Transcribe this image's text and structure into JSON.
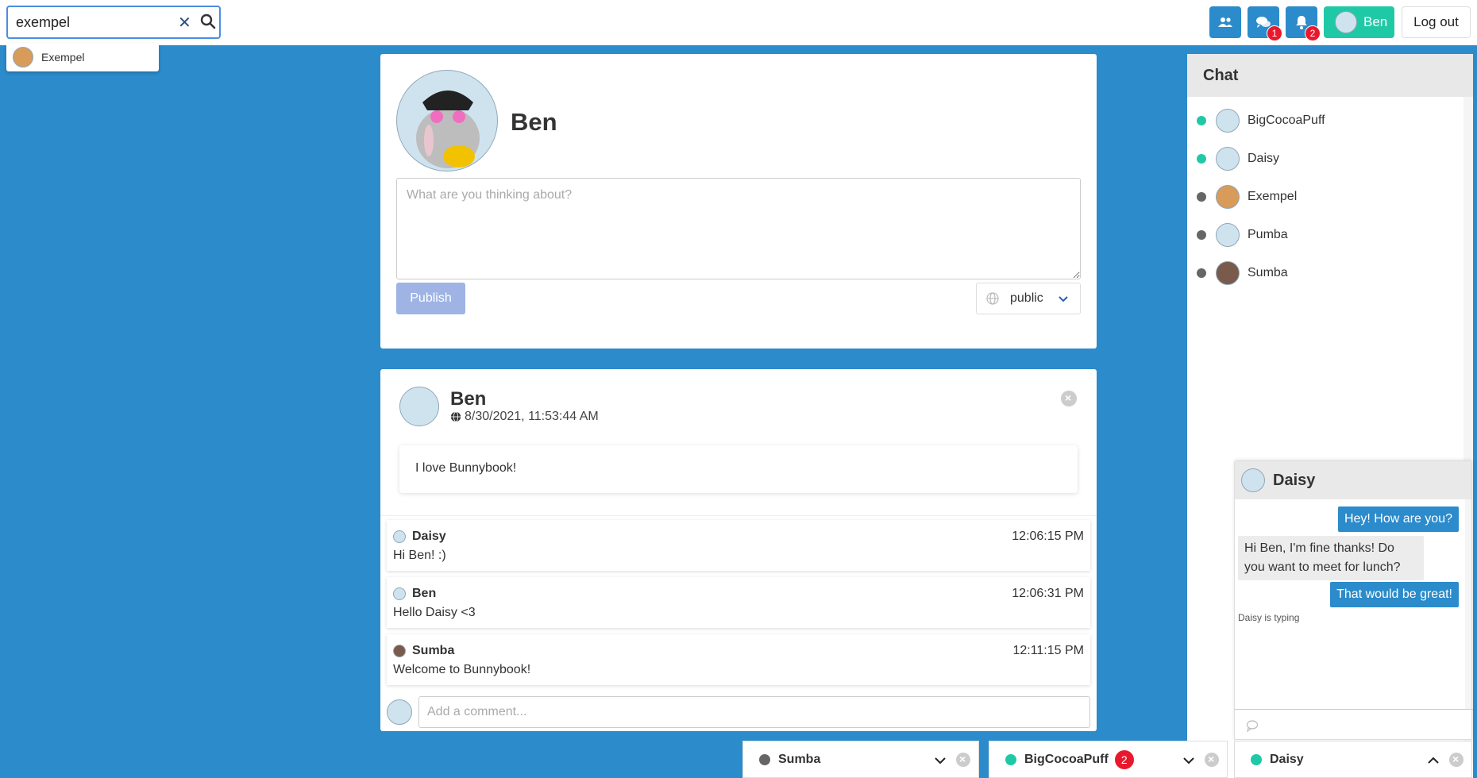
{
  "search": {
    "value": "exempel",
    "results": [
      {
        "name": "Exempel"
      }
    ]
  },
  "navbar": {
    "chat_badge": "1",
    "notif_badge": "2",
    "profile_label": "Ben",
    "logout_label": "Log out"
  },
  "composer": {
    "name": "Ben",
    "placeholder": "What are you thinking about?",
    "publish_label": "Publish",
    "privacy": "public"
  },
  "post": {
    "author": "Ben",
    "timestamp": "8/30/2021, 11:53:44 AM",
    "body": "I love Bunnybook!",
    "comments": [
      {
        "author": "Daisy",
        "time": "12:06:15 PM",
        "text": "Hi Ben! :)"
      },
      {
        "author": "Ben",
        "time": "12:06:31 PM",
        "text": "Hello Daisy <3"
      },
      {
        "author": "Sumba",
        "time": "12:11:15 PM",
        "text": "Welcome to Bunnybook!"
      }
    ],
    "comment_placeholder": "Add a comment..."
  },
  "chat_sidebar": {
    "title": "Chat",
    "users": [
      {
        "name": "BigCocoaPuff",
        "status": "online"
      },
      {
        "name": "Daisy",
        "status": "online"
      },
      {
        "name": "Exempel",
        "status": "offline"
      },
      {
        "name": "Pumba",
        "status": "offline"
      },
      {
        "name": "Sumba",
        "status": "offline"
      }
    ]
  },
  "chat_window": {
    "name": "Daisy",
    "messages": [
      {
        "from": "me",
        "text": "Hey! How are you?"
      },
      {
        "from": "them",
        "text": "Hi Ben, I'm fine thanks! Do you want to meet for lunch?"
      },
      {
        "from": "me",
        "text": "That would be great!"
      }
    ],
    "typing": "Daisy is typing"
  },
  "chat_tabs": [
    {
      "name": "Sumba",
      "status": "offline",
      "badge": ""
    },
    {
      "name": "BigCocoaPuff",
      "status": "online",
      "badge": "2"
    },
    {
      "name": "Daisy",
      "status": "online",
      "badge": ""
    }
  ],
  "colors": {
    "online": "#20c9a6",
    "offline": "#666666",
    "primary": "#2b8bcb",
    "badge": "#e8192c"
  }
}
